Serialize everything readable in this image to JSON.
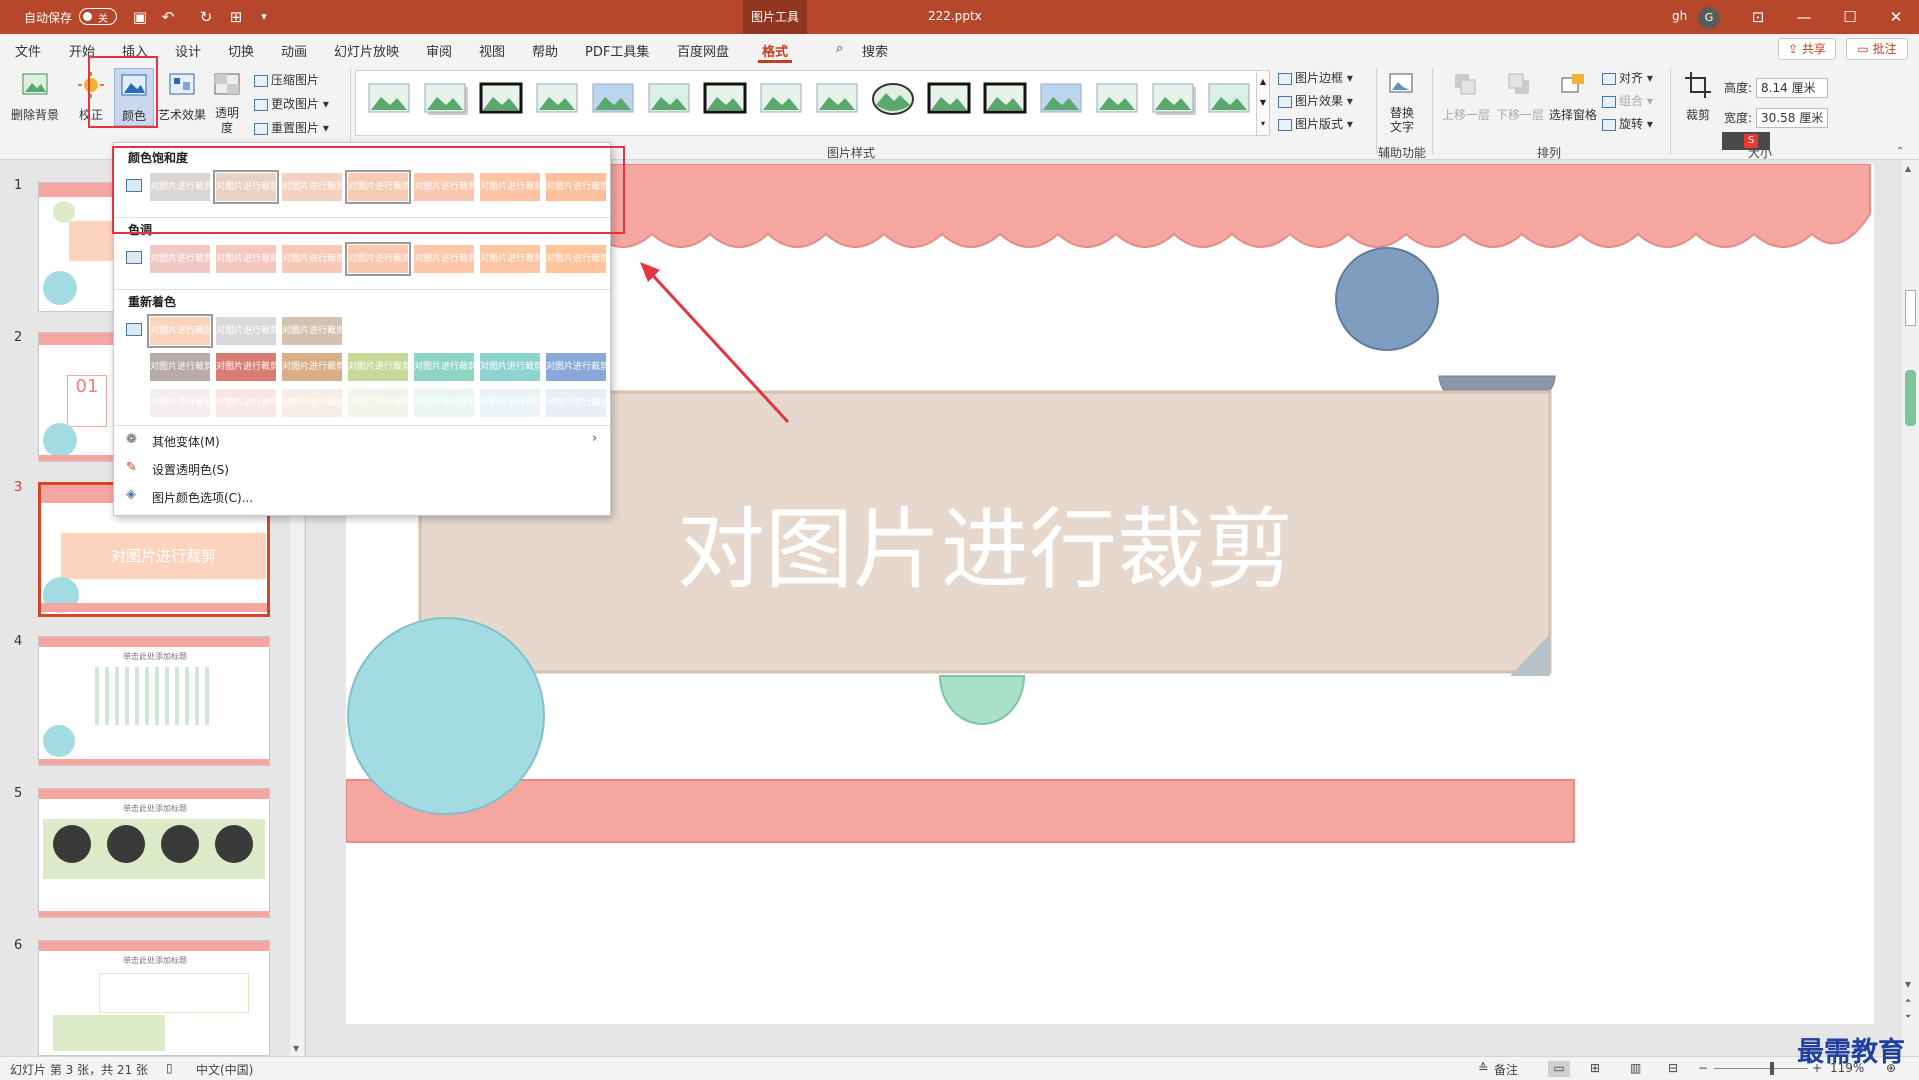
{
  "titlebar": {
    "autosave_label": "自动保存",
    "autosave_state": "关",
    "context_tab": "图片工具",
    "filename": "222.pptx",
    "user": "gh",
    "avatar_initial": "G"
  },
  "tabs": [
    "文件",
    "开始",
    "插入",
    "设计",
    "切换",
    "动画",
    "幻灯片放映",
    "审阅",
    "视图",
    "帮助",
    "PDF工具集",
    "百度网盘",
    "格式"
  ],
  "search_label": "搜索",
  "share_label": "共享",
  "comment_label": "批注",
  "ribbon": {
    "remove_bg": "删除背景",
    "correct": "校正",
    "color": "颜色",
    "art_effects": "艺术效果",
    "transparency": "透明度",
    "compress": "压缩图片",
    "change": "更改图片",
    "reset": "重置图片",
    "border": "图片边框",
    "effects": "图片效果",
    "layout": "图片版式",
    "alt_text": "替换文字",
    "bring_forward": "上移一层",
    "send_backward": "下移一层",
    "selection_pane": "选择窗格",
    "align": "对齐",
    "group": "组合",
    "rotate": "旋转",
    "crop": "裁剪",
    "height_label": "高度:",
    "height_value": "8.14 厘米",
    "width_label": "宽度:",
    "width_value": "30.58 厘米",
    "group_picture_styles": "图片样式",
    "group_accessibility": "辅助功能",
    "group_arrange": "排列",
    "group_size": "大小"
  },
  "dropdown": {
    "saturation_title": "颜色饱和度",
    "tone_title": "色调",
    "recolor_title": "重新着色",
    "swatch_text": "对图片进行裁剪",
    "saturation_colors": [
      "#d9d6d4",
      "#e8d2c5",
      "#f3d2c0",
      "#f5cbb6",
      "#f9c7ad",
      "#fcc3a4",
      "#fec09c"
    ],
    "tone_colors": [
      "#f2c9c2",
      "#f5c8bd",
      "#f8c8b7",
      "#fac7b1",
      "#fcc6aa",
      "#fec5a2",
      "#ffc49a"
    ],
    "recolor_row1": [
      "#fcd3bd",
      "#d9d9d9",
      "#d3c2b2"
    ],
    "recolor_row2": [
      "#b8aaa6",
      "#d97d74",
      "#d9ae88",
      "#c7d99a",
      "#8fd6c2",
      "#8fd3cf",
      "#8aa7d9"
    ],
    "recolor_row3": [
      "#f3eded",
      "#f9e7e5",
      "#f7ede4",
      "#f1f4e9",
      "#e9f6f1",
      "#e9f4f4",
      "#e9eef6"
    ],
    "more_variants": "其他变体(M)",
    "set_transparent": "设置透明色(S)",
    "color_options": "图片颜色选项(C)..."
  },
  "slide": {
    "title": "对图片进行裁剪"
  },
  "thumbs": {
    "nums": [
      "1",
      "2",
      "3",
      "4",
      "5",
      "6"
    ],
    "thumb2_num": "01",
    "thumb3_title": "对图片进行裁剪",
    "thumb_sub": "单击此处添加标题"
  },
  "status": {
    "slide_info": "幻灯片 第 3 张，共 21 张",
    "lang": "中文(中国)",
    "notes": "备注",
    "zoom": "119%"
  },
  "watermark": "最需教育",
  "colors": {
    "accent": "#b7472a",
    "banner": "#f6a6a0",
    "tan_box": "#e7d8ce",
    "blue_circle": "#7f9dbf",
    "cyan_circle": "#a3dbe2",
    "mint": "#a9e0c8"
  }
}
